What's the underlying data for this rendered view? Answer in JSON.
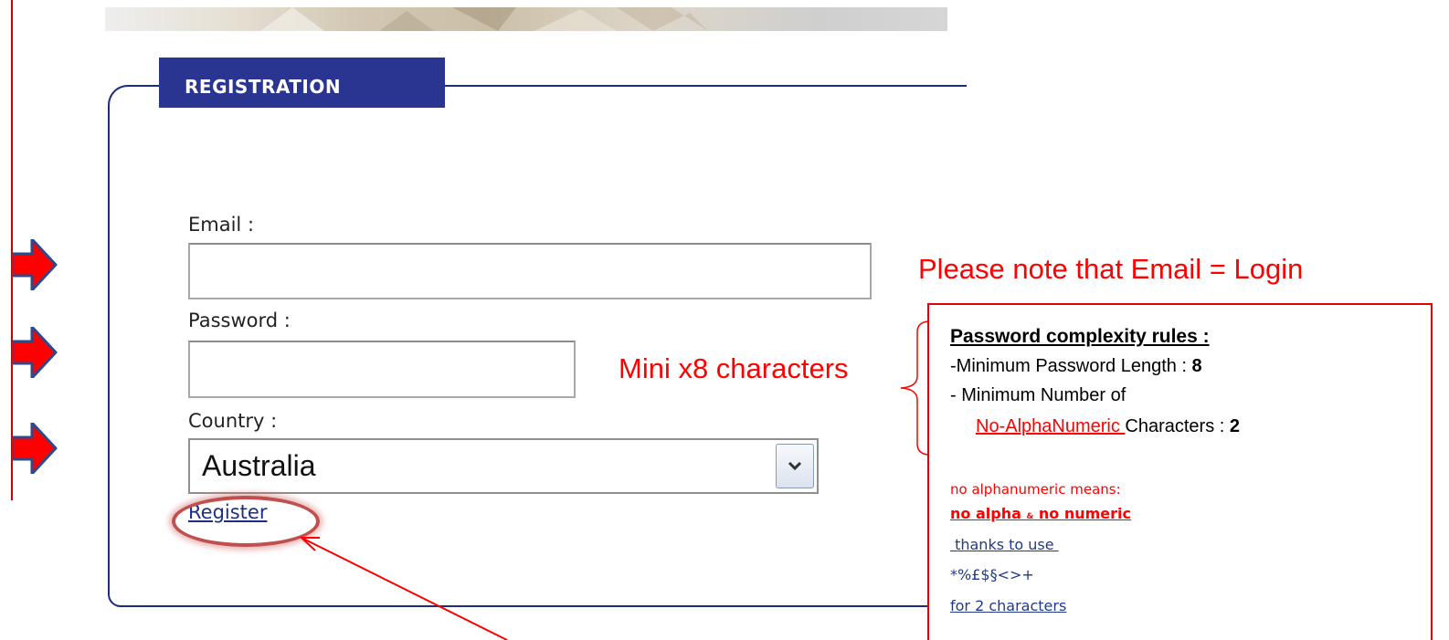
{
  "colors": {
    "annotation_red": "#ff0000",
    "legend_navy": "#293591",
    "border_navy": "#1b2d7f",
    "link_blue": "#1c2f88"
  },
  "form": {
    "legend": "REGISTRATION",
    "email_label": "Email :",
    "email_value": "",
    "password_label": "Password :",
    "password_value": "",
    "country_label": "Country :",
    "country_selected": "Australia",
    "dropdown_icon": "chevron-down-icon",
    "register_link": "Register"
  },
  "annotations": {
    "email_note": "Please note that Email = Login",
    "password_note": "Mini x8 characters",
    "pointer_icons": [
      "arrow-right-icon",
      "arrow-right-icon",
      "arrow-right-icon"
    ],
    "rules": {
      "title": "Password complexity rules :",
      "line1_text": "-Minimum Password Length : ",
      "line1_value": "8",
      "line2_text": "- Minimum Number of",
      "line3_highlight": "No-AlphaNumeric ",
      "line3_text": "Characters : ",
      "line3_value": "2",
      "explain_1": "no alphanumeric means:",
      "explain_2a": "no alpha",
      "explain_2amp": "&",
      "explain_2b": "no numeric",
      "explain_3": " thanks to use ",
      "explain_4": "*%£$§<>+",
      "explain_5": "for 2 characters"
    }
  }
}
